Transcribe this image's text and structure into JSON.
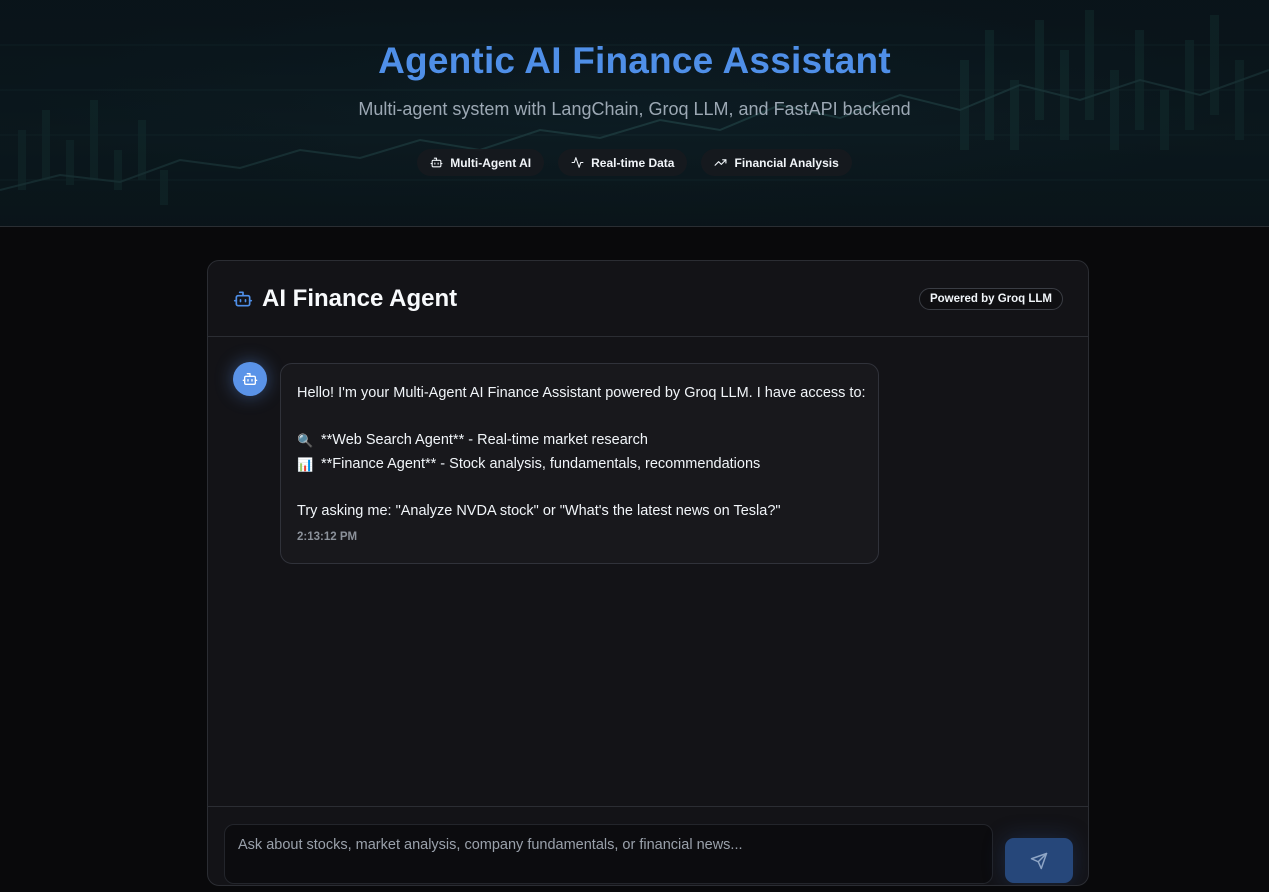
{
  "hero": {
    "title": "Agentic AI Finance Assistant",
    "subtitle": "Multi-agent system with LangChain, Groq LLM, and FastAPI backend",
    "badges": [
      {
        "label": "Multi-Agent AI",
        "icon": "robot-icon"
      },
      {
        "label": "Real-time Data",
        "icon": "activity-icon"
      },
      {
        "label": "Financial Analysis",
        "icon": "trending-up-icon"
      }
    ]
  },
  "panel": {
    "title": "AI Finance Agent",
    "title_icon": "robot-icon",
    "powered_by": "Powered by Groq LLM"
  },
  "message": {
    "sender_icon": "robot-icon",
    "intro": "Hello! I'm your Multi-Agent AI Finance Assistant powered by Groq LLM. I have access to:",
    "agents": [
      {
        "emoji": "🔍",
        "text": "**Web Search Agent** - Real-time market research"
      },
      {
        "emoji": "📊",
        "text": "**Finance Agent** - Stock analysis, fundamentals, recommendations"
      }
    ],
    "prompt": "Try asking me: \"Analyze NVDA stock\" or \"What's the latest news on Tesla?\"",
    "timestamp": "2:13:12 PM"
  },
  "composer": {
    "placeholder": "Ask about stocks, market analysis, company fundamentals, or financial news...",
    "value": "",
    "send_icon": "send-icon"
  },
  "colors": {
    "accent": "#4f8fe8",
    "avatar": "#5a93e8",
    "send_button": "#26477a",
    "background": "#09090b",
    "panel": "#131317"
  }
}
